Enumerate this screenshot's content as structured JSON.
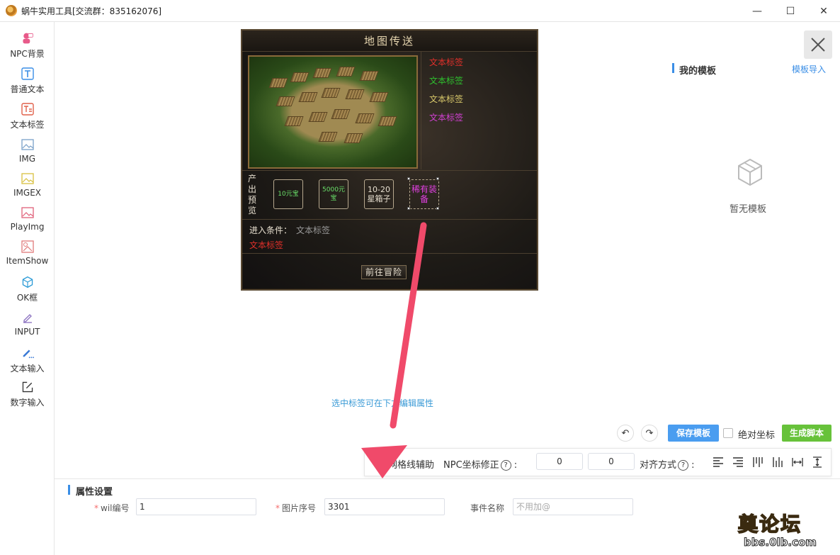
{
  "window": {
    "title": "蜗牛实用工具[交流群：835162076]",
    "controls": {
      "minimize": "—",
      "maximize": "☐",
      "close": "✕"
    }
  },
  "sidebar": {
    "items": [
      {
        "label": "NPC背景",
        "icon": "npc-background-icon",
        "color": "#e85a8a"
      },
      {
        "label": "普通文本",
        "icon": "text-icon",
        "color": "#3a8ee6"
      },
      {
        "label": "文本标签",
        "icon": "text-tag-icon",
        "color": "#e0604a"
      },
      {
        "label": "IMG",
        "icon": "image-icon",
        "color": "#7aa0c8"
      },
      {
        "label": "IMGEX",
        "icon": "image-ex-icon",
        "color": "#d8c040"
      },
      {
        "label": "PlayImg",
        "icon": "play-image-icon",
        "color": "#e0607a"
      },
      {
        "label": "ItemShow",
        "icon": "item-show-icon",
        "color": "#e07a7a"
      },
      {
        "label": "OK框",
        "icon": "ok-box-icon",
        "color": "#2a9ad6"
      },
      {
        "label": "INPUT",
        "icon": "input-icon",
        "color": "#8a70c0"
      },
      {
        "label": "文本输入",
        "icon": "text-input-icon",
        "color": "#3a7ad6"
      },
      {
        "label": "数字输入",
        "icon": "number-input-icon",
        "color": "#333333"
      }
    ]
  },
  "game_panel": {
    "title": "地图传送",
    "tags": [
      {
        "text": "文本标签",
        "color": "#e0302a"
      },
      {
        "text": "文本标签",
        "color": "#2ec02e"
      },
      {
        "text": "文本标签",
        "color": "#d8c86a"
      },
      {
        "text": "文本标签",
        "color": "#d040d0"
      }
    ],
    "output_label": "产出预览",
    "slots": [
      {
        "text": "10元宝",
        "color": "#6ae06a"
      },
      {
        "text": "5000元宝",
        "color": "#6ae06a"
      },
      {
        "text": "10-20星箱子",
        "color": "#e8e0d0"
      },
      {
        "text": "稀有装备",
        "color": "#e040e0"
      }
    ],
    "condition_label": "进入条件：",
    "condition_value": "文本标签",
    "condition_tag": "文本标签",
    "go_button": "前往冒险"
  },
  "canvas_hint": "选中标签可在下方编辑属性",
  "templates": {
    "title": "我的模板",
    "import_label": "模板导入",
    "empty_text": "暂无模板"
  },
  "actions": {
    "undo": "↶",
    "redo": "↷",
    "save_template": "保存模板",
    "absolute_coords": "绝对坐标",
    "generate_script": "生成脚本"
  },
  "toolbar": {
    "grid_helper": "网格线辅助",
    "npc_offset_label": "NPC坐标修正",
    "help": "?",
    "colon": ":",
    "offset_x": "0",
    "offset_y": "0",
    "align_label": "对齐方式"
  },
  "properties": {
    "title": "属性设置",
    "wil_label": "wil编号",
    "wil_value": "1",
    "image_index_label": "图片序号",
    "image_index_value": "3301",
    "event_name_label": "事件名称",
    "event_name_placeholder": "不用加@"
  },
  "watermark": {
    "text_top": "奠论坛",
    "text_bottom": "bbs.0lb.com"
  }
}
